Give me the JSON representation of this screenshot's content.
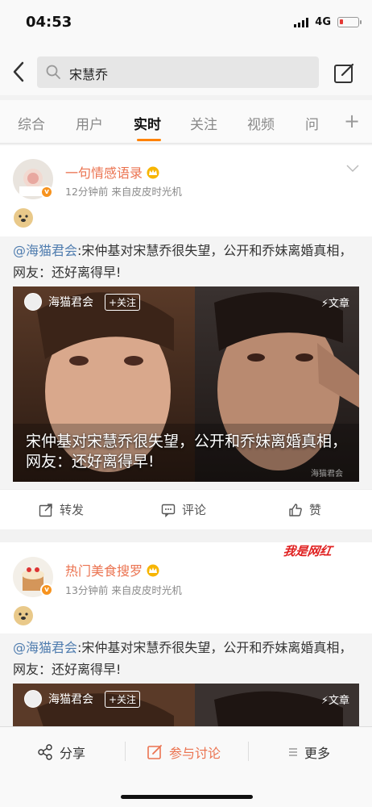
{
  "status": {
    "time": "04:53",
    "network": "4G"
  },
  "search": {
    "query": "宋慧乔"
  },
  "tabs": [
    {
      "label": "综合"
    },
    {
      "label": "用户"
    },
    {
      "label": "实时"
    },
    {
      "label": "关注"
    },
    {
      "label": "视频"
    },
    {
      "label": "问"
    }
  ],
  "posts": [
    {
      "username": "一句情感语录",
      "meta": "12分钟前   来自皮皮时光机",
      "repost_mention": "@海猫君会",
      "repost_text": ":宋仲基对宋慧乔很失望，公开和乔妹离婚真相，网友：还好离得早!",
      "card_author": "海猫君会",
      "follow_label": "+关注",
      "article_label": "文章",
      "caption": "宋仲基对宋慧乔很失望，公开和乔妹离婚真相，网友：还好离得早!",
      "watermark": "海猫君会",
      "actions": {
        "repost": "转发",
        "comment": "评论",
        "like": "赞"
      }
    },
    {
      "username": "热门美食搜罗",
      "meta": "13分钟前   来自皮皮时光机",
      "repost_mention": "@海猫君会",
      "repost_text": ":宋仲基对宋慧乔很失望，公开和乔妹离婚真相，网友：还好离得早!",
      "card_author": "海猫君会",
      "follow_label": "+关注",
      "article_label": "文章"
    }
  ],
  "overlay_logo": "我是网红",
  "bottom": {
    "share": "分享",
    "discuss": "参与讨论",
    "more": "更多"
  },
  "colors": {
    "accent": "#ff8200",
    "username": "#eb7350",
    "mention": "#507daf"
  }
}
